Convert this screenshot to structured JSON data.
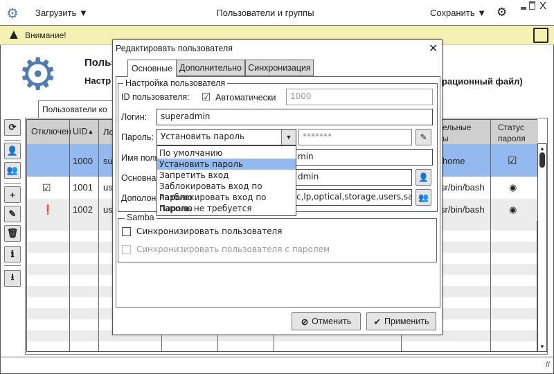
{
  "titlebar": {
    "load": "Загрузить",
    "title": "Пользователи и группы",
    "save": "Сохранить"
  },
  "warning": {
    "text": "Внимание!"
  },
  "header": {
    "title_fragment": "Польз",
    "subtitle_fragment": "Настр",
    "subtitle_tail": "рационный файл)"
  },
  "main_tab": {
    "label": "Пользователи ко"
  },
  "table": {
    "columns": [
      "Отключен",
      "UID",
      "Ло",
      "ельные",
      "ы",
      "Статус",
      "пароля"
    ],
    "rows": [
      {
        "uid": "1000",
        "login": "su",
        "shell": "home",
        "selected": true
      },
      {
        "uid": "1001",
        "login": "us",
        "shell": "sr/bin/bash"
      },
      {
        "uid": "1002",
        "login": "us",
        "shell": "sr/bin/bash"
      }
    ]
  },
  "dialog": {
    "title": "Редактировать пользователя",
    "tabs": [
      "Основные",
      "Дополнительно",
      "Синхронизация"
    ],
    "group_title": "Настройка пользователя",
    "id_label": "ID пользователя:",
    "auto_label": "Автоматически",
    "id_value": "1000",
    "login_label": "Логин:",
    "login_value": "superadmin",
    "password_label": "Пароль:",
    "password_mode": "Установить пароль",
    "password_value": "*******",
    "name_label": "Имя поль",
    "name_value": "min",
    "primary_label": "Основна",
    "primary_value": "dmin",
    "extra_label": "Дополон",
    "extra_value": "c,lp,optical,storage,users,sam",
    "dropdown": [
      "По умолчанию",
      "Установить пароль",
      "Запретить вход",
      "Заблокировать вход по паролю",
      "Разблокировать вход по паролю",
      "Пароль не требуется"
    ],
    "samba_title": "Samba",
    "sync_user": "Синхронизировать пользователя",
    "sync_pass": "Синхронизировать пользователя с паролем",
    "cancel": "Отменить",
    "apply": "Применить"
  },
  "colors": {
    "selected": "#93b9ee",
    "warning": "#f4f1b2",
    "accent": "#4f7db3"
  }
}
